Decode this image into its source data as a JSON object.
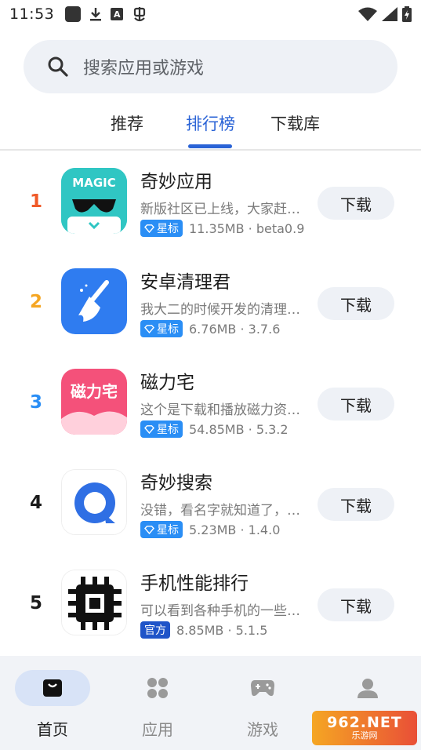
{
  "status_bar": {
    "time": "11:53",
    "left_icons": [
      "square-icon",
      "download-icon",
      "a-icon",
      "bug-icon"
    ],
    "right_icons": [
      "wifi-icon",
      "signal-icon",
      "battery-icon"
    ]
  },
  "search": {
    "placeholder": "搜索应用或游戏"
  },
  "tabs": [
    {
      "label": "推荐",
      "active": false
    },
    {
      "label": "排行榜",
      "active": true
    },
    {
      "label": "下载库",
      "active": false
    }
  ],
  "apps": [
    {
      "rank": "1",
      "rank_color": "#f05a28",
      "name": "奇妙应用",
      "desc": "新版社区已上线，大家赶快来体验吧",
      "badge": "星标",
      "badge_type": "star",
      "meta": "11.35MB · beta0.9",
      "button": "下载",
      "icon": "magic-app-icon"
    },
    {
      "rank": "2",
      "rank_color": "#f5a623",
      "name": "安卓清理君",
      "desc": "我大二的时候开发的清理工具",
      "badge": "星标",
      "badge_type": "star",
      "meta": "6.76MB · 3.7.6",
      "button": "下载",
      "icon": "broom-icon"
    },
    {
      "rank": "3",
      "rank_color": "#2a8ef5",
      "name": "磁力宅",
      "desc": "这个是下载和播放磁力资源的应用",
      "badge": "星标",
      "badge_type": "star",
      "meta": "54.85MB · 5.3.2",
      "button": "下载",
      "icon": "cili-zhai-icon"
    },
    {
      "rank": "4",
      "rank_color": "#1c1c1c",
      "name": "奇妙搜索",
      "desc": "没错，看名字就知道了，这是一个搜索",
      "badge": "星标",
      "badge_type": "star",
      "meta": "5.23MB · 1.4.0",
      "button": "下载",
      "icon": "search-q-icon"
    },
    {
      "rank": "5",
      "rank_color": "#1c1c1c",
      "name": "手机性能排行",
      "desc": "可以看到各种手机的一些性能排行",
      "badge": "官方",
      "badge_type": "official",
      "meta": "8.85MB · 5.1.5",
      "button": "下载",
      "icon": "chip-icon"
    }
  ],
  "bottom_nav": [
    {
      "label": "首页",
      "active": true,
      "icon": "home-bag-icon"
    },
    {
      "label": "应用",
      "active": false,
      "icon": "apps-grid-icon"
    },
    {
      "label": "游戏",
      "active": false,
      "icon": "gamepad-icon"
    },
    {
      "label": "",
      "active": false,
      "icon": "profile-icon"
    }
  ],
  "watermark": {
    "top": "962.NET",
    "bottom": "乐游网"
  },
  "colors": {
    "accent": "#2a63d6",
    "search_bg": "#eef1f6",
    "nav_bg": "#f1f3f7"
  }
}
